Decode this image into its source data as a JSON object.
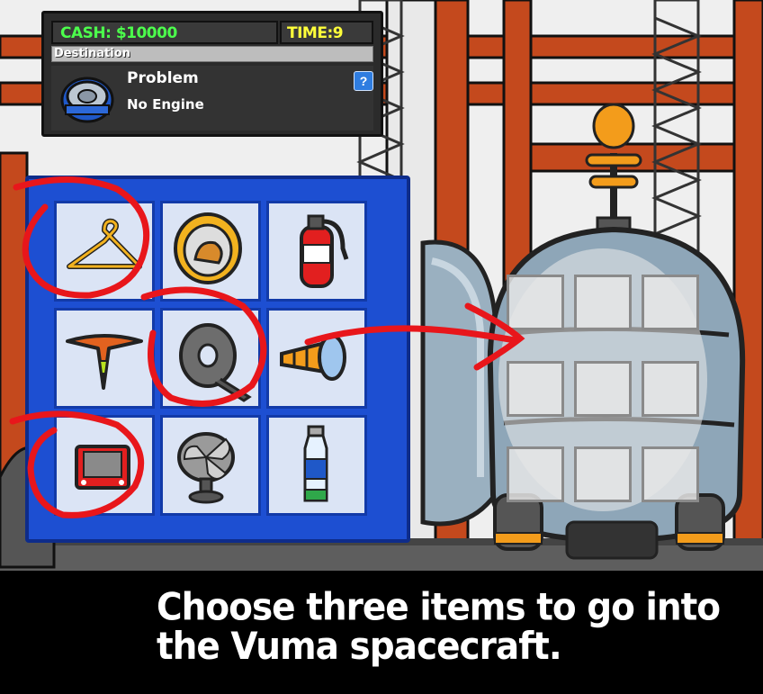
{
  "hud": {
    "cash_label": "CASH: $10000",
    "time_label": "TIME:9",
    "destination_label": "Destination",
    "problem_title": "Problem",
    "problem_detail": "No Engine",
    "help_label": "?"
  },
  "inventory": {
    "items": [
      {
        "id": "hanger",
        "icon": "coat-hanger-icon",
        "circled": true
      },
      {
        "id": "hamster-wheel",
        "icon": "hamster-wheel-icon",
        "circled": false
      },
      {
        "id": "fire-extinguisher",
        "icon": "fire-extinguisher-icon",
        "circled": false
      },
      {
        "id": "traffic-cone",
        "icon": "traffic-cone-icon",
        "circled": false
      },
      {
        "id": "duct-tape",
        "icon": "duct-tape-icon",
        "circled": true
      },
      {
        "id": "flashlight",
        "icon": "flashlight-icon",
        "circled": false
      },
      {
        "id": "etch-a-sketch",
        "icon": "drawing-toy-icon",
        "circled": true
      },
      {
        "id": "fan",
        "icon": "desk-fan-icon",
        "circled": false
      },
      {
        "id": "water-bottle",
        "icon": "water-bottle-icon",
        "circled": false
      }
    ]
  },
  "ship": {
    "slot_count": 9
  },
  "caption": {
    "line1": "Choose three items to go into",
    "line2": "the Vuma spacecraft."
  },
  "colors": {
    "cash": "#4cff4c",
    "time": "#ffff3a",
    "blueprint": "#1d4fd2",
    "annotation": "#e8161b",
    "girder": "#c4491d"
  }
}
